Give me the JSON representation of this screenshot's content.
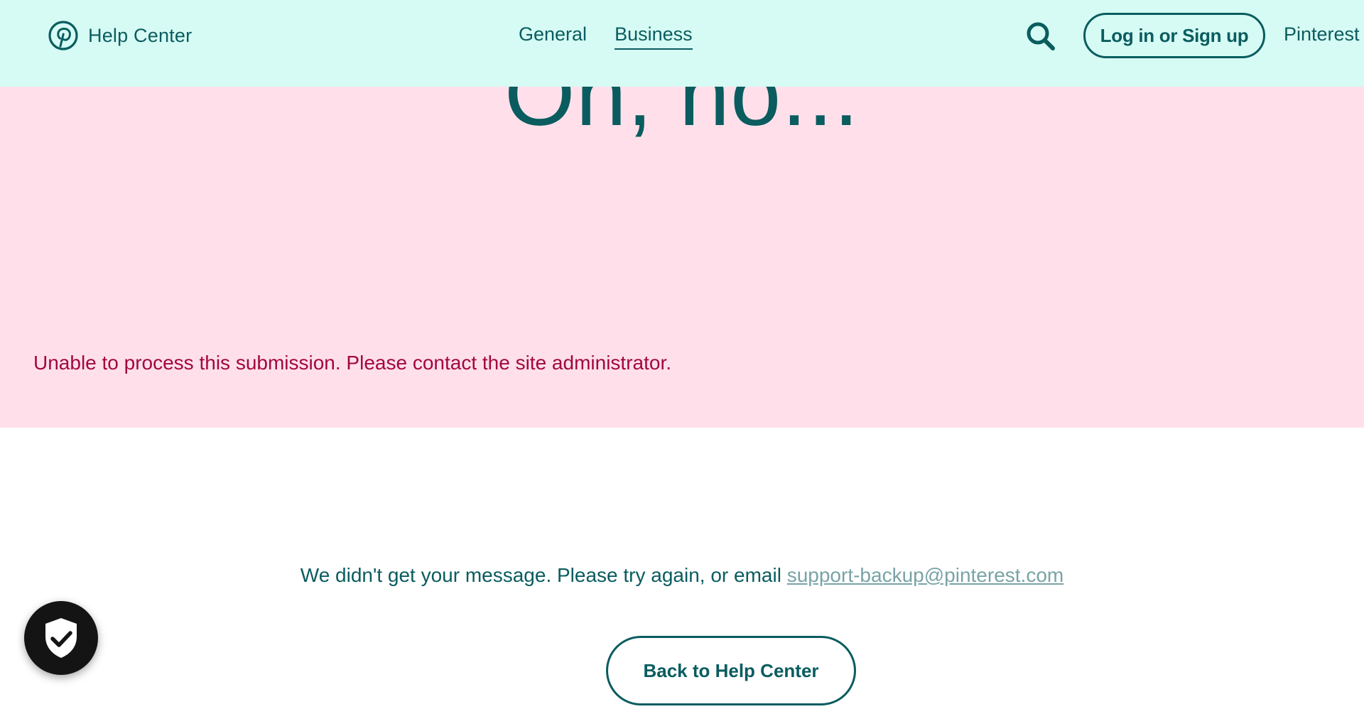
{
  "header": {
    "brand_label": "Help Center",
    "nav": [
      {
        "label": "General"
      },
      {
        "label": "Business",
        "active": true
      }
    ],
    "search_icon": "search-icon",
    "login_label": "Log in or Sign up",
    "pinterest_label": "Pinterest"
  },
  "error_band": {
    "title": "Oh, no...",
    "message": "Unable to process this submission. Please contact the site administrator."
  },
  "content": {
    "retry_text": "We didn't get your message. Please try again, or email ",
    "support_email": "support-backup@pinterest.com",
    "back_label": "Back to Help Center"
  },
  "privacy_badge": {
    "icon": "shield-check-icon"
  },
  "colors": {
    "header_bg": "#d6fbf4",
    "band_bg": "#ffe0ea",
    "teal": "#0a5c5f",
    "error_red": "#a3063f",
    "link_muted": "#7aa3a6",
    "badge_bg": "#141414"
  }
}
